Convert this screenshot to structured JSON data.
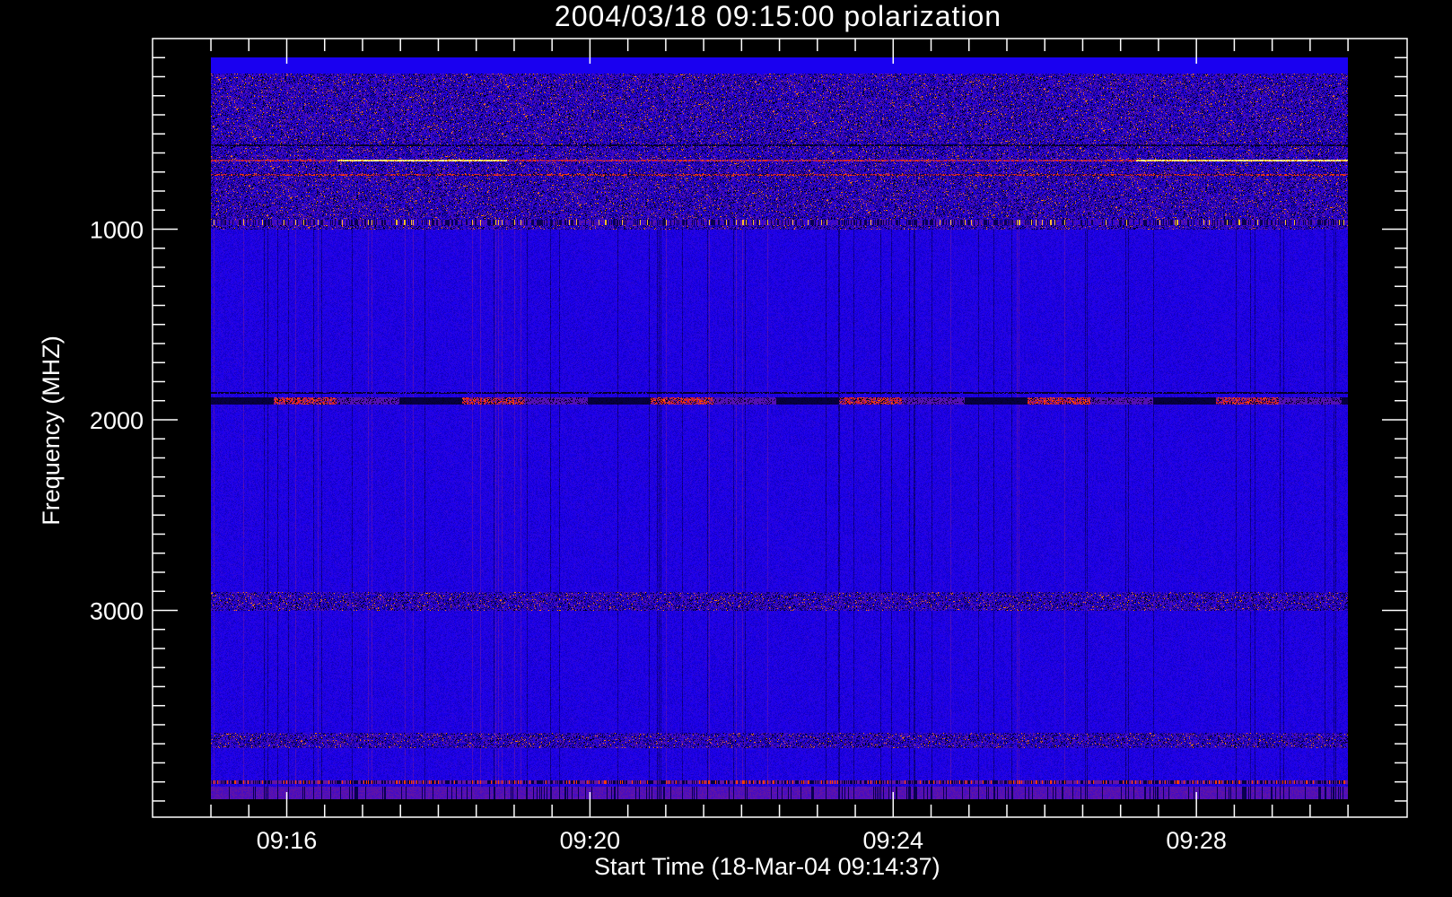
{
  "chart_data": {
    "type": "heatmap",
    "title": "2004/03/18 09:15:00 polarization",
    "xlabel": "Start Time (18-Mar-04 09:14:37)",
    "ylabel": "Frequency (MHZ)",
    "x_unit": "minutes after 09:15:00",
    "xlim": [
      -0.77,
      15.78
    ],
    "ylim": [
      0,
      4085
    ],
    "y_inverted": true,
    "data_extent": {
      "time_minutes": [
        0,
        15
      ],
      "frequency_mhz": [
        100,
        3990
      ]
    },
    "x_major_ticks": [
      {
        "value": 1,
        "label": "09:16"
      },
      {
        "value": 5,
        "label": "09:20"
      },
      {
        "value": 9,
        "label": "09:24"
      },
      {
        "value": 13,
        "label": "09:28"
      }
    ],
    "x_minor_step_minutes": 0.5,
    "y_major_ticks": [
      {
        "value": 1000,
        "label": "1000"
      },
      {
        "value": 2000,
        "label": "2000"
      },
      {
        "value": 3000,
        "label": "3000"
      }
    ],
    "y_minor_step_mhz": 100,
    "colormap": [
      "#000000",
      "#1a00f0",
      "#7a1a8a",
      "#ff2000",
      "#ffa000",
      "#ffffa0"
    ],
    "background_color": "#1a00f0",
    "features": [
      {
        "freq_mhz": [
          100,
          180
        ],
        "kind": "flat"
      },
      {
        "freq_mhz": [
          180,
          1000
        ],
        "kind": "noisy"
      },
      {
        "freq_mhz": [
          555,
          565
        ],
        "kind": "dark-line"
      },
      {
        "freq_mhz": [
          635,
          645
        ],
        "kind": "bright-line"
      },
      {
        "freq_mhz": [
          710,
          720
        ],
        "kind": "red-dark-line"
      },
      {
        "freq_mhz": [
          950,
          975
        ],
        "kind": "yellow-stripes"
      },
      {
        "freq_mhz": [
          1850,
          1860
        ],
        "kind": "dark-line"
      },
      {
        "freq_mhz": [
          1880,
          1920
        ],
        "kind": "red-dark-segments"
      },
      {
        "freq_mhz": [
          2900,
          3000
        ],
        "kind": "noisy"
      },
      {
        "freq_mhz": [
          3640,
          3720
        ],
        "kind": "noisy"
      },
      {
        "freq_mhz": [
          3890,
          3910
        ],
        "kind": "red-dark-stripes"
      },
      {
        "freq_mhz": [
          3920,
          3990
        ],
        "kind": "purple"
      }
    ]
  }
}
